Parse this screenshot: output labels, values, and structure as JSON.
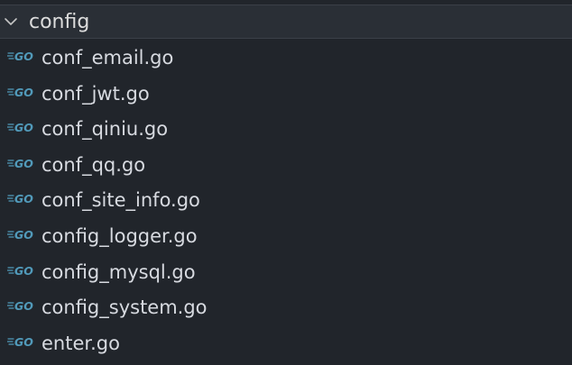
{
  "explorer": {
    "folder": {
      "name": "config",
      "expanded": true,
      "chevron_icon": "chevron-down-icon"
    },
    "file_icon": "go-file-icon",
    "colors": {
      "background": "#21252b",
      "header_background": "#2a2f36",
      "text": "#d7dae0",
      "go_icon": "#519aba"
    },
    "files": [
      {
        "name": "conf_email.go"
      },
      {
        "name": "conf_jwt.go"
      },
      {
        "name": "conf_qiniu.go"
      },
      {
        "name": "conf_qq.go"
      },
      {
        "name": "conf_site_info.go"
      },
      {
        "name": "config_logger.go"
      },
      {
        "name": "config_mysql.go"
      },
      {
        "name": "config_system.go"
      },
      {
        "name": "enter.go"
      }
    ]
  }
}
